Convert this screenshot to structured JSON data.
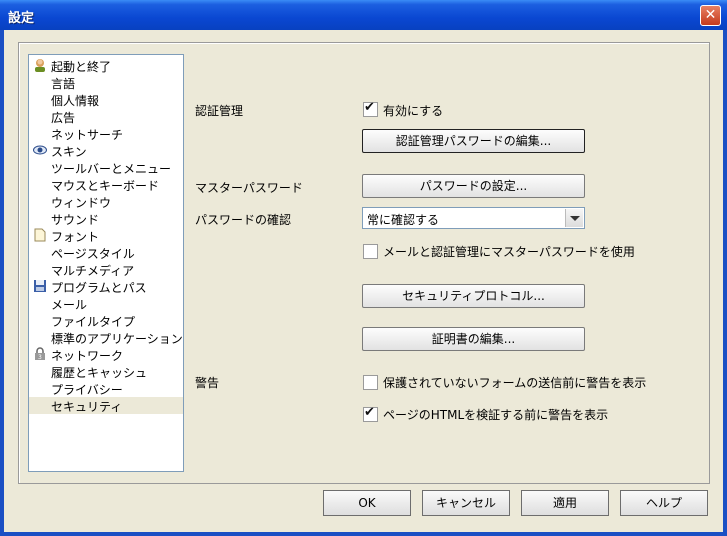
{
  "window": {
    "title": "設定"
  },
  "sidebar": {
    "items": [
      {
        "label": "起動と終了",
        "icon": "person-icon"
      },
      {
        "label": "言語"
      },
      {
        "label": "個人情報"
      },
      {
        "label": "広告"
      },
      {
        "label": "ネットサーチ"
      },
      {
        "label": "スキン",
        "icon": "eye-icon"
      },
      {
        "label": "ツールバーとメニュー"
      },
      {
        "label": "マウスとキーボード"
      },
      {
        "label": "ウィンドウ"
      },
      {
        "label": "サウンド"
      },
      {
        "label": "フォント",
        "icon": "document-icon"
      },
      {
        "label": "ページスタイル"
      },
      {
        "label": "マルチメディア"
      },
      {
        "label": "プログラムとパス",
        "icon": "disk-icon"
      },
      {
        "label": "メール"
      },
      {
        "label": "ファイルタイプ"
      },
      {
        "label": "標準のアプリケーション"
      },
      {
        "label": "ネットワーク",
        "icon": "lock-icon"
      },
      {
        "label": "履歴とキャッシュ"
      },
      {
        "label": "プライバシー"
      },
      {
        "label": "セキュリティ",
        "selected": true
      }
    ]
  },
  "security": {
    "auth_label": "認証管理",
    "enable_label": "有効にする",
    "enable_checked": true,
    "edit_auth_button": "認証管理パスワードの編集...",
    "master_label": "マスターパスワード",
    "set_password_button": "パスワードの設定...",
    "confirm_label": "パスワードの確認",
    "confirm_value": "常に確認する",
    "use_master_label": "メールと認証管理にマスターパスワードを使用",
    "use_master_checked": false,
    "protocols_button": "セキュリティプロトコル...",
    "certs_button": "証明書の編集...",
    "warning_label": "警告",
    "warn_unsecure_label": "保護されていないフォームの送信前に警告を表示",
    "warn_unsecure_checked": false,
    "warn_html_label": "ページのHTMLを検証する前に警告を表示",
    "warn_html_checked": true
  },
  "dialog_buttons": {
    "ok": "OK",
    "cancel": "キャンセル",
    "apply": "適用",
    "help": "ヘルプ"
  }
}
